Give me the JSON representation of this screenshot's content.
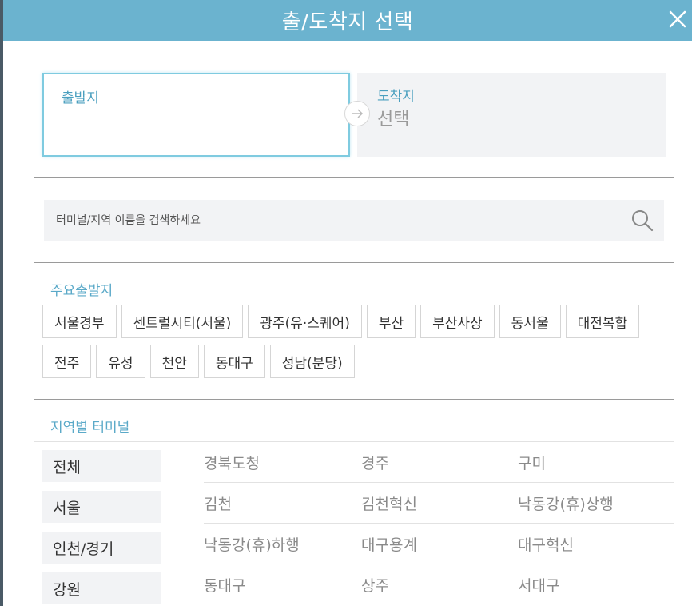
{
  "header": {
    "title": "출/도착지 선택",
    "close_icon": "close-icon"
  },
  "route": {
    "departure_label": "출발지",
    "departure_value": "",
    "arrival_label": "도착지",
    "arrival_value": "선택"
  },
  "search": {
    "placeholder": "터미널/지역 이름을 검색하세요",
    "value": ""
  },
  "major": {
    "title": "주요출발지",
    "rows": [
      [
        "서울경부",
        "센트럴시티(서울)",
        "광주(유·스퀘어)",
        "부산",
        "부산사상",
        "동서울",
        "대전복합"
      ],
      [
        "전주",
        "유성",
        "천안",
        "동대구",
        "성남(분당)"
      ]
    ]
  },
  "regional": {
    "title": "지역별 터미널",
    "regions": [
      "전체",
      "서울",
      "인천/경기",
      "강원"
    ],
    "terminals": [
      [
        "경북도청",
        "경주",
        "구미"
      ],
      [
        "김천",
        "김천혁신",
        "낙동강(휴)상행"
      ],
      [
        "낙동강(휴)하행",
        "대구용계",
        "대구혁신"
      ],
      [
        "동대구",
        "상주",
        "서대구"
      ]
    ]
  },
  "colors": {
    "header": "#6bb3cf",
    "accent": "#5aa9c8",
    "panel": "#f2f3f5"
  }
}
